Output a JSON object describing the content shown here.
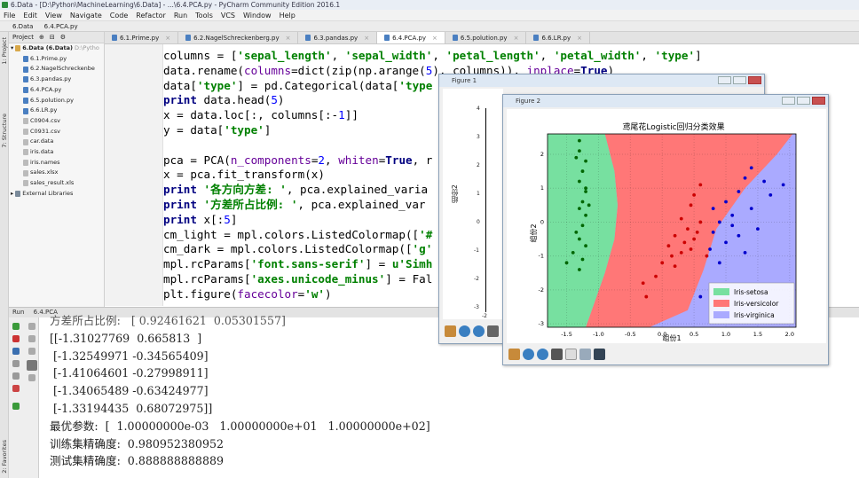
{
  "window": {
    "title": "6.Data - [D:\\Python\\MachineLearning\\6.Data] - ...\\6.4.PCA.py - PyCharm Community Edition 2016.1"
  },
  "menu": [
    "File",
    "Edit",
    "View",
    "Navigate",
    "Code",
    "Refactor",
    "Run",
    "Tools",
    "VCS",
    "Window",
    "Help"
  ],
  "navbar": {
    "project": "6.Data",
    "file": "6.4.PCA.py"
  },
  "project_panel": {
    "header": "Project",
    "root": "6.Data (6.Data)",
    "root_path": "D:\\Pytho",
    "files": [
      "6.1.Prime.py",
      "6.2.NagelSchreckenbe",
      "6.3.pandas.py",
      "6.4.PCA.py",
      "6.5.polution.py",
      "6.6.LR.py",
      "C0904.csv",
      "C0931.csv",
      "car.data",
      "iris.data",
      "iris.names",
      "sales.xlsx",
      "sales_result.xls"
    ],
    "external": "External Libraries"
  },
  "side_tabs": {
    "project": "1: Project",
    "structure": "7: Structure",
    "favorites": "2: Favorites"
  },
  "editor_tabs": [
    "6.1.Prime.py",
    "6.2.NagelSchreckenberg.py",
    "6.3.pandas.py",
    "6.4.PCA.py",
    "6.5.polution.py",
    "6.6.LR.py"
  ],
  "run_panel": {
    "label": "Run",
    "config": "6.4.PCA"
  },
  "console_lines": [
    "方差所占比例:   [ 0.92461621  0.05301557]",
    "[[-1.31027769  0.665813  ]",
    " [-1.32549971 -0.34565409]",
    " [-1.41064601 -0.27998911]",
    " [-1.34065489 -0.63424977]",
    " [-1.33194435  0.68072975]]",
    "最优参数:  [  1.00000000e-03   1.00000000e+01   1.00000000e+02]",
    "训练集精确度:  0.980952380952",
    "测试集精确度:  0.888888888889"
  ],
  "figure1": {
    "title": "Figure 1",
    "ylabel": "组份2",
    "yticks": [
      "4",
      "3",
      "2",
      "1",
      "0",
      "-1",
      "-2",
      "-3"
    ],
    "xtick": "-2"
  },
  "figure2": {
    "title": "Figure 2",
    "chart_title": "鸢尾花Logistic回归分类效果",
    "xlabel": "组份1",
    "ylabel": "组份2",
    "xticks": [
      "-1.5",
      "-1.0",
      "-0.5",
      "0.0",
      "0.5",
      "1.0",
      "1.5",
      "2.0"
    ],
    "yticks": [
      "2",
      "1",
      "0",
      "-1",
      "-2",
      "-3"
    ],
    "legend": [
      "Iris-setosa",
      "Iris-versicolor",
      "Iris-virginica"
    ]
  },
  "colors": {
    "setosa_region": "#77e0a0",
    "versicolor_region": "#ff7777",
    "virginica_region": "#aaaaff",
    "setosa_pt": "#006600",
    "versicolor_pt": "#cc0000",
    "virginica_pt": "#0000cc"
  },
  "chart_data": {
    "type": "scatter",
    "title": "鸢尾花Logistic回归分类效果",
    "xlabel": "组份1",
    "ylabel": "组份2",
    "xlim": [
      -1.8,
      2.1
    ],
    "ylim": [
      -3.1,
      2.6
    ],
    "legend_position": "bottom-right",
    "grid": true,
    "series": [
      {
        "name": "Iris-setosa",
        "color": "#006600",
        "points": [
          [
            -1.3,
            2.4
          ],
          [
            -1.3,
            2.1
          ],
          [
            -1.2,
            1.8
          ],
          [
            -1.25,
            1.5
          ],
          [
            -1.3,
            1.2
          ],
          [
            -1.2,
            0.9
          ],
          [
            -1.25,
            0.6
          ],
          [
            -1.3,
            0.4
          ],
          [
            -1.2,
            0.2
          ],
          [
            -1.25,
            -0.1
          ],
          [
            -1.35,
            -0.3
          ],
          [
            -1.3,
            -0.5
          ],
          [
            -1.2,
            -0.7
          ],
          [
            -1.4,
            -0.9
          ],
          [
            -1.25,
            -1.1
          ],
          [
            -1.5,
            -1.2
          ],
          [
            -1.3,
            -1.4
          ],
          [
            -1.2,
            1.0
          ],
          [
            -1.15,
            0.5
          ],
          [
            -1.35,
            1.9
          ]
        ]
      },
      {
        "name": "Iris-versicolor",
        "color": "#cc0000",
        "points": [
          [
            0.6,
            1.1
          ],
          [
            0.5,
            0.8
          ],
          [
            0.45,
            0.5
          ],
          [
            0.3,
            0.1
          ],
          [
            0.4,
            -0.2
          ],
          [
            0.2,
            -0.4
          ],
          [
            0.1,
            -0.7
          ],
          [
            0.3,
            -0.9
          ],
          [
            0.0,
            -1.2
          ],
          [
            -0.1,
            -1.6
          ],
          [
            0.2,
            -1.3
          ],
          [
            0.5,
            -0.5
          ],
          [
            0.6,
            0.0
          ],
          [
            0.35,
            -0.6
          ],
          [
            -0.3,
            -1.8
          ],
          [
            -0.25,
            -2.2
          ],
          [
            0.15,
            -1.0
          ],
          [
            0.45,
            -0.8
          ],
          [
            0.55,
            -0.3
          ],
          [
            0.7,
            -1.0
          ]
        ]
      },
      {
        "name": "Iris-virginica",
        "color": "#0000cc",
        "points": [
          [
            1.4,
            1.6
          ],
          [
            1.6,
            1.2
          ],
          [
            1.2,
            0.9
          ],
          [
            1.0,
            0.6
          ],
          [
            1.4,
            0.4
          ],
          [
            1.1,
            0.2
          ],
          [
            0.9,
            0.0
          ],
          [
            0.8,
            -0.3
          ],
          [
            1.2,
            -0.4
          ],
          [
            1.5,
            -0.2
          ],
          [
            1.0,
            -0.6
          ],
          [
            0.75,
            -0.8
          ],
          [
            1.3,
            -0.9
          ],
          [
            0.9,
            -1.2
          ],
          [
            1.7,
            0.8
          ],
          [
            1.9,
            1.1
          ],
          [
            1.3,
            1.3
          ],
          [
            0.8,
            0.4
          ],
          [
            1.1,
            -0.1
          ],
          [
            0.6,
            -2.2
          ]
        ]
      }
    ]
  }
}
